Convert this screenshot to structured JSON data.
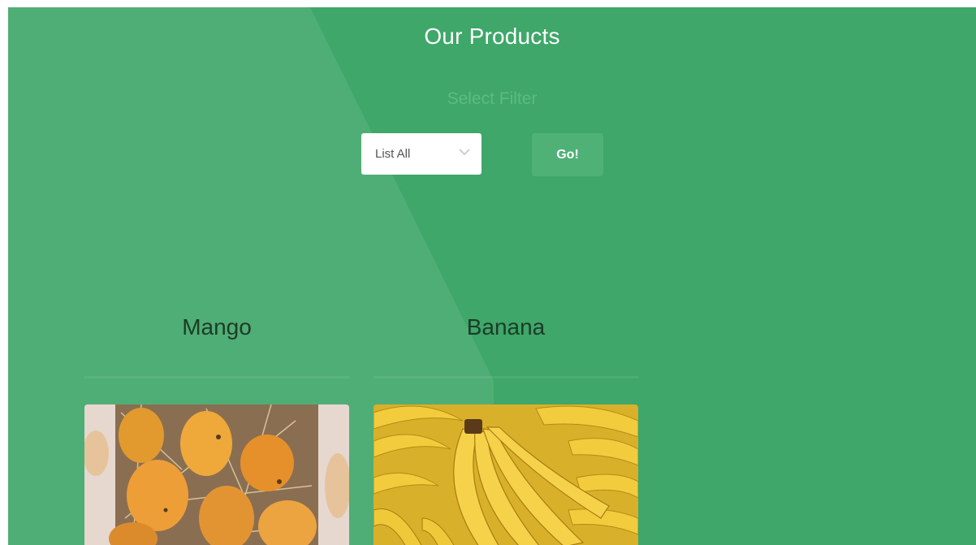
{
  "header": {
    "title": "Our Products"
  },
  "filter": {
    "label": "Select Filter",
    "selected": "List All",
    "go_label": "Go!"
  },
  "products": [
    {
      "name": "Mango",
      "image": "mango-photo"
    },
    {
      "name": "Banana",
      "image": "banana-photo"
    }
  ],
  "colors": {
    "background": "#3ea769",
    "button": "#4fb176",
    "title": "#ffffff"
  }
}
